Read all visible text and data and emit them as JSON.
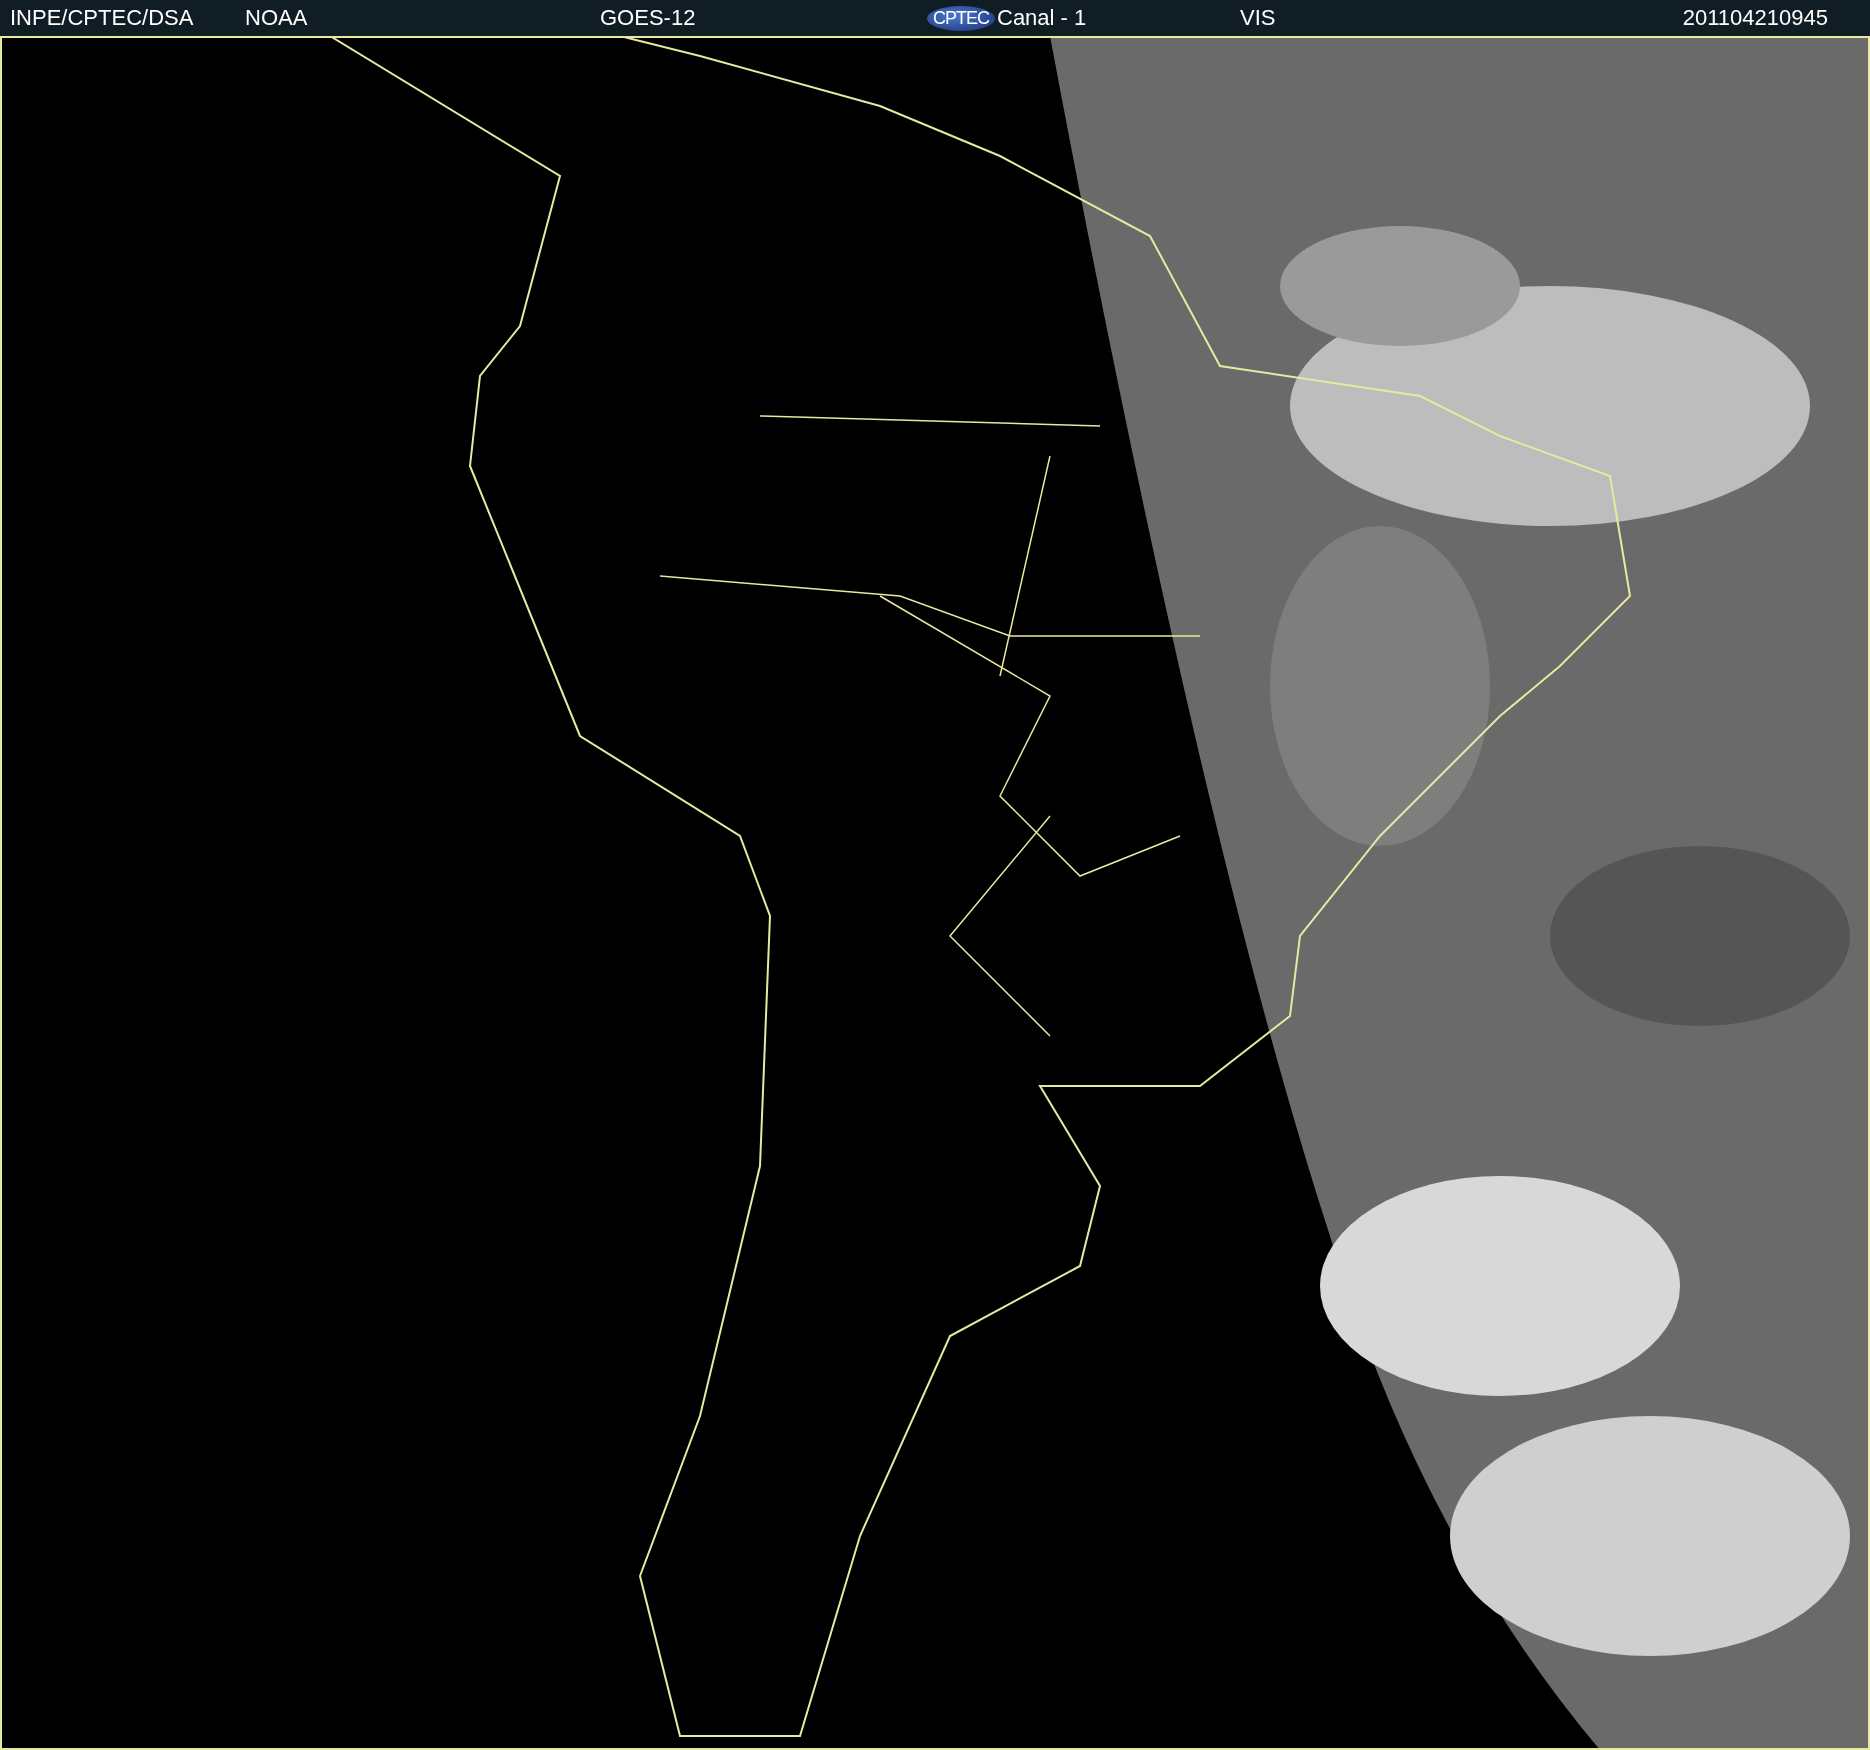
{
  "header": {
    "items": [
      {
        "kind": "text",
        "text": "INPE/CPTEC/DSA"
      },
      {
        "kind": "text",
        "text": "NOAA"
      },
      {
        "kind": "text",
        "text": "GOES-12"
      },
      {
        "kind": "logo",
        "text": "CPTEC"
      },
      {
        "kind": "text",
        "text": "Canal - 1"
      },
      {
        "kind": "text",
        "text": "VIS"
      },
      {
        "kind": "text",
        "text": "201104210945"
      }
    ]
  }
}
